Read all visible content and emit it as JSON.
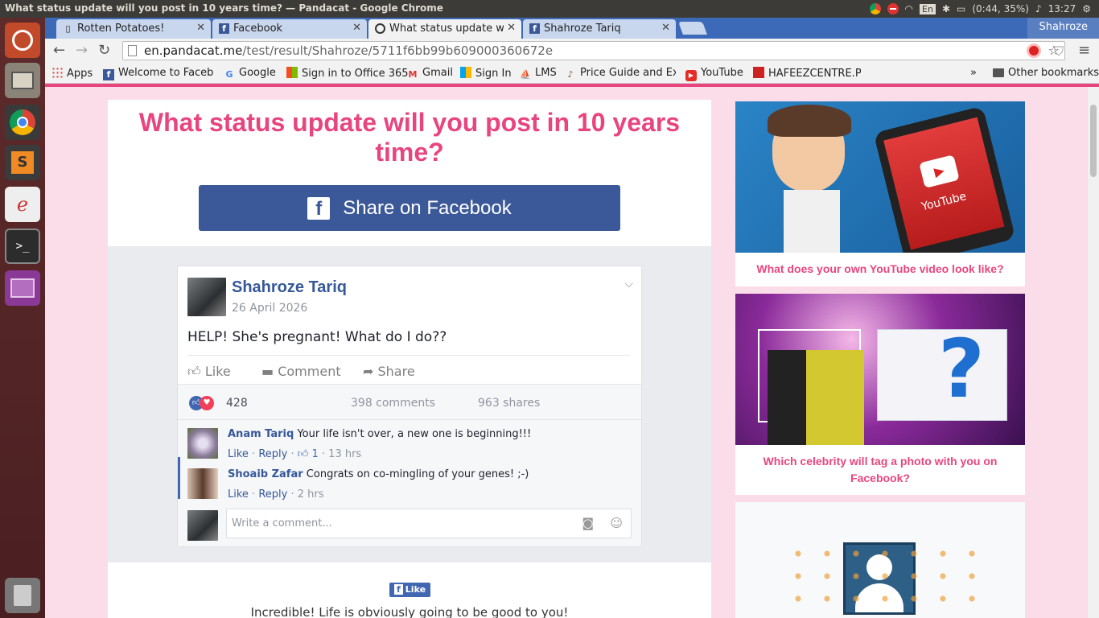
{
  "system": {
    "window_title": "What status update will you post in 10 years time? — Pandacat - Google Chrome",
    "battery": "(0:44, 35%)",
    "keyboard": "En",
    "clock": "13:27",
    "user": "Shahroze"
  },
  "tabs": [
    {
      "label": "Rotten Potatoes!",
      "icon": "page-icon"
    },
    {
      "label": "Facebook",
      "icon": "facebook-icon"
    },
    {
      "label": "What status update will",
      "icon": "pandacat-icon"
    },
    {
      "label": "Shahroze Tariq",
      "icon": "facebook-icon"
    }
  ],
  "toolbar": {
    "url_domain": "en.pandacat.me",
    "url_path": "/test/result/Shahroze/5711f6bb99b609000360672e"
  },
  "bookmarks": [
    {
      "label": "Apps"
    },
    {
      "label": "Welcome to Facebo"
    },
    {
      "label": "Google"
    },
    {
      "label": "Sign in to Office 365"
    },
    {
      "label": "Gmail"
    },
    {
      "label": "Sign In"
    },
    {
      "label": "LMS"
    },
    {
      "label": "Price Guide and Exc"
    },
    {
      "label": "YouTube"
    },
    {
      "label": "HAFEEZCENTRE.PK"
    },
    {
      "label": "»"
    },
    {
      "label": "Other bookmarks"
    }
  ],
  "page": {
    "title": "What status update will you post in 10 years time?",
    "share_label": "Share on Facebook",
    "like_label": "Like",
    "result_text": "Incredible! Life is obviously going to be good to you!"
  },
  "post": {
    "author": "Shahroze Tariq",
    "date": "26 April 2026",
    "text": "HELP! She's pregnant! What do I do??",
    "actions": {
      "like": "Like",
      "comment": "Comment",
      "share": "Share"
    },
    "reactions": "428",
    "comments_count": "398 comments",
    "shares_count": "963 shares",
    "comments": [
      {
        "name": "Anam Tariq",
        "text": "Your life isn't over, a new one is beginning!!!",
        "like": "Like",
        "reply": "Reply",
        "likes": "1",
        "time": "13 hrs"
      },
      {
        "name": "Shoaib Zafar",
        "text": "Congrats on co-mingling of your genes! ;-)",
        "like": "Like",
        "reply": "Reply",
        "time": "2 hrs"
      }
    ],
    "write_placeholder": "Write a comment..."
  },
  "sidebar": [
    {
      "caption": "What does your own YouTube video look like?",
      "image_text": "YouTube"
    },
    {
      "caption": "Which celebrity will tag a photo with you on Facebook?",
      "image_text": "?"
    },
    {
      "caption": ""
    }
  ]
}
